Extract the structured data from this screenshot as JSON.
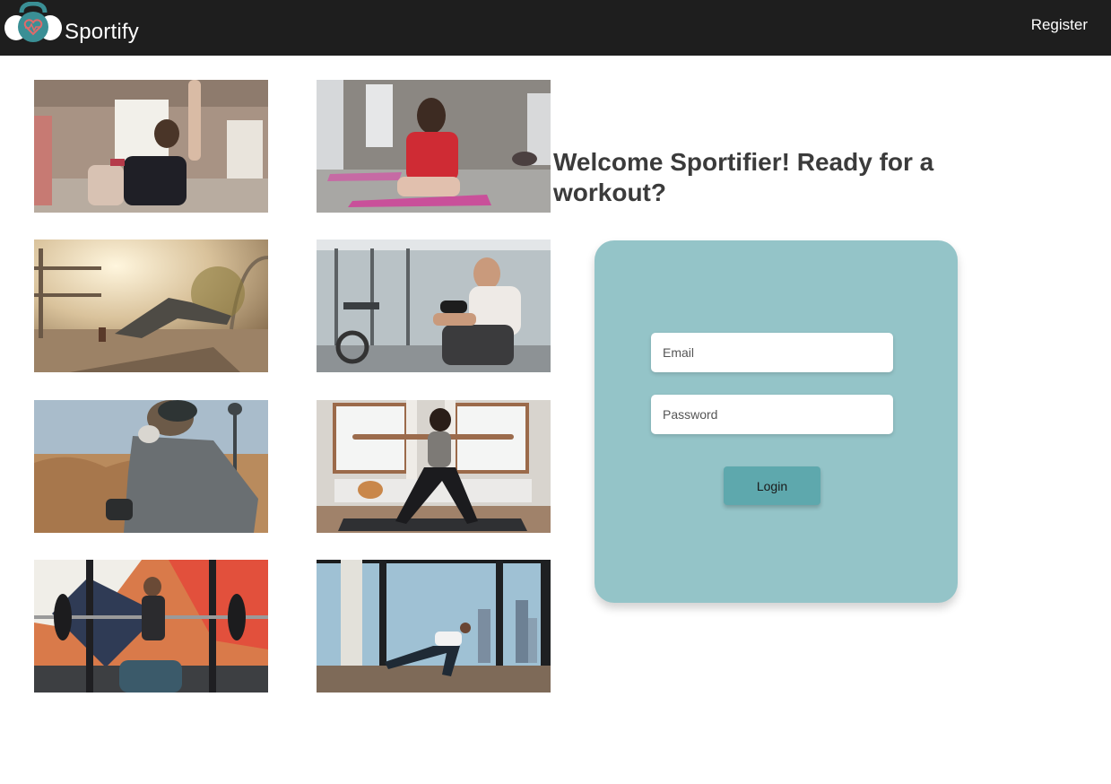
{
  "nav": {
    "brand_name": "Sportify",
    "logo_icon": "kettlebell-heart-logo",
    "register_label": "Register"
  },
  "gallery": {
    "photos": [
      {
        "subject": "women-dumbbell-class-photo"
      },
      {
        "subject": "woman-plank-yoga-mat-photo"
      },
      {
        "subject": "outdoor-stretching-sunset-photo"
      },
      {
        "subject": "man-dumbbell-curl-gym-photo"
      },
      {
        "subject": "senior-man-running-field-photo"
      },
      {
        "subject": "woman-yoga-warrior-pose-photo"
      },
      {
        "subject": "bench-press-spotter-photo"
      },
      {
        "subject": "man-lunge-city-window-photo"
      }
    ]
  },
  "welcome": {
    "heading": "Welcome Sportifier! Ready for a workout?"
  },
  "login": {
    "email_placeholder": "Email",
    "password_placeholder": "Password",
    "button_label": "Login"
  },
  "colors": {
    "navbar": "#1e1e1e",
    "card": "#94c4c8",
    "button": "#5ea8ad",
    "heading": "#3b3b3b",
    "logo_teal": "#3a8f95"
  }
}
